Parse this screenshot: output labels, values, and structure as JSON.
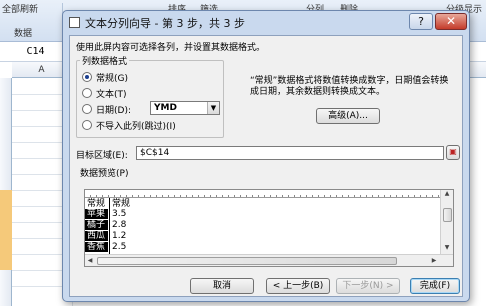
{
  "excel": {
    "ribbon": {
      "left_group_label_top": "全部刷新",
      "left_group_label_bottom": "数据",
      "sort_label": "排序",
      "filter_label": "筛选",
      "split_label": "分列",
      "remove_dup_label": "删除",
      "subtotal_label": "分级显示"
    },
    "name_box": "C14",
    "column_a": "A",
    "row_numbers": [
      "",
      "",
      "",
      "",
      "",
      "",
      "",
      "",
      "",
      "",
      "",
      "",
      "",
      ""
    ]
  },
  "dialog": {
    "title": "文本分列向导 - 第 3 步，共 3 步",
    "help_label": "?",
    "close_label": "✕",
    "instruction": "使用此屏内容可选择各列，并设置其数据格式。",
    "column_format": {
      "group_title": "列数据格式",
      "options": [
        {
          "label": "常规(G)",
          "selected": true
        },
        {
          "label": "文本(T)",
          "selected": false
        },
        {
          "label": "日期(D):",
          "selected": false
        },
        {
          "label": "不导入此列(跳过)(I)",
          "selected": false
        }
      ],
      "date_format_value": "YMD"
    },
    "description": "“常规”数据格式将数值转换成数字，日期值会转换成日期，其余数据则转换成文本。",
    "advanced_button": "高级(A)...",
    "destination_label": "目标区域(E):",
    "destination_value": "$C$14",
    "preview_title": "数据预览(P)",
    "preview": {
      "headers": [
        "常规",
        "常规"
      ],
      "rows": [
        [
          "苹果",
          "3.5"
        ],
        [
          "橘子",
          "2.8"
        ],
        [
          "西瓜",
          "1.2"
        ],
        [
          "香蕉",
          "2.5"
        ]
      ]
    },
    "buttons": {
      "cancel": "取消",
      "back": "< 上一步(B)",
      "next": "下一步(N) >",
      "finish": "完成(F)"
    }
  }
}
